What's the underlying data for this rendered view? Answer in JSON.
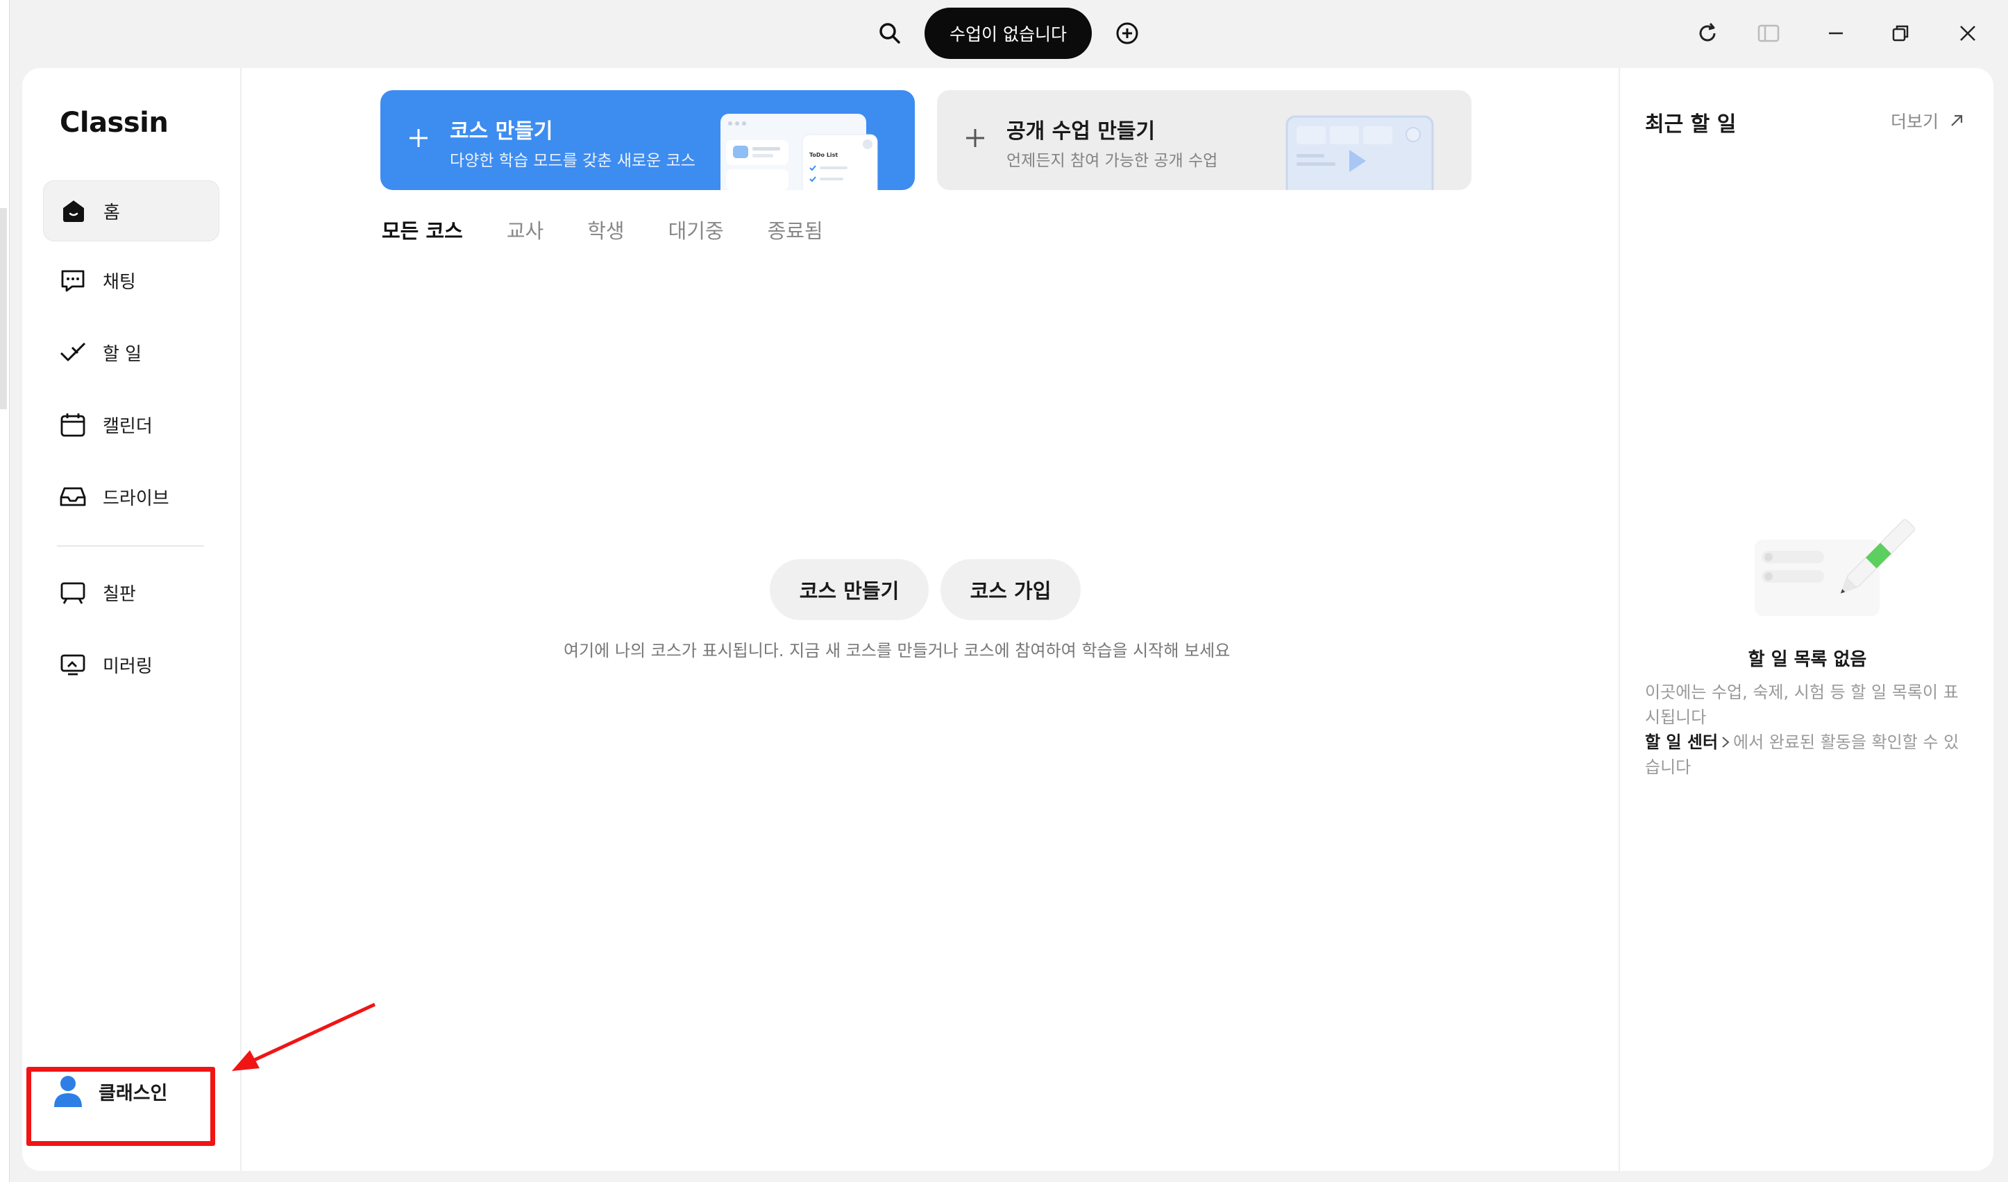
{
  "titlebar": {
    "status_pill": "수업이 없습니다",
    "icons": [
      "search-icon",
      "add-circle-icon",
      "refresh-icon",
      "sidebar-toggle-icon",
      "minimize-icon",
      "maximize-icon",
      "close-icon"
    ]
  },
  "app": {
    "logo": "Classin"
  },
  "sidebar": {
    "items": [
      {
        "label": "홈",
        "icon": "home-icon",
        "active": true
      },
      {
        "label": "채팅",
        "icon": "chat-icon"
      },
      {
        "label": "할 일",
        "icon": "todo-check-icon"
      },
      {
        "label": "캘린더",
        "icon": "calendar-icon"
      },
      {
        "label": "드라이브",
        "icon": "drive-icon"
      },
      {
        "label": "칠판",
        "icon": "blackboard-icon"
      },
      {
        "label": "미러링",
        "icon": "mirroring-icon"
      }
    ],
    "profile": {
      "name": "클래스인",
      "icon": "avatar-icon"
    }
  },
  "cards": {
    "create_course": {
      "title": "코스 만들기",
      "subtitle": "다양한 학습 모드를 갖춘 새로운 코스",
      "illus_label": "ToDo List"
    },
    "create_public": {
      "title": "공개 수업 만들기",
      "subtitle": "언제든지 참여 가능한 공개 수업"
    }
  },
  "tabs": [
    {
      "label": "모든 코스",
      "active": true
    },
    {
      "label": "교사"
    },
    {
      "label": "학생"
    },
    {
      "label": "대기중"
    },
    {
      "label": "종료됨"
    }
  ],
  "empty_state": {
    "create_button": "코스 만들기",
    "join_button": "코스 가입",
    "message": "여기에 나의 코스가 표시됩니다. 지금 새 코스를 만들거나 코스에 참여하여 학습을 시작해 보세요"
  },
  "right_panel": {
    "title": "최근 할 일",
    "more": "더보기",
    "empty_title": "할 일 목록 없음",
    "desc_line1": "이곳에는 수업, 숙제, 시험 등 할 일 목록이 표시됩니다",
    "desc_link": "할 일 센터",
    "desc_line2": "에서 완료된 활동을 확인할 수 있습니다"
  },
  "colors": {
    "accent_blue": "#3d8cf0",
    "annotation_red": "#f01414"
  }
}
